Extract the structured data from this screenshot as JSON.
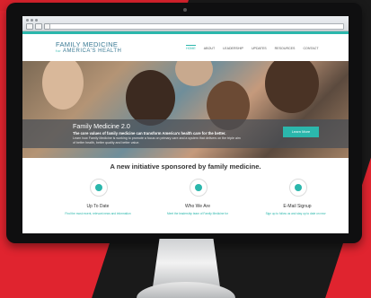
{
  "browser": {
    "url": ""
  },
  "header": {
    "logo_line1": "FAMILY MEDICINE",
    "logo_for": "for",
    "logo_line2": "AMERICA'S HEALTH",
    "nav": [
      "HOME",
      "ABOUT",
      "LEADERSHIP",
      "UPDATES",
      "RESOURCES",
      "CONTACT"
    ]
  },
  "hero": {
    "title": "Family Medicine 2.0",
    "subtitle": "The core values of family medicine can transform America's health care for the better.",
    "body": "Learn how Family Medicine is working to promote a focus on primary care and a system that delivers on the triple aim of better health, better quality and better value.",
    "button_label": "Learn More"
  },
  "main": {
    "heading": "A new initiative sponsored by family medicine.",
    "features": [
      {
        "icon": "book-icon",
        "title": "Up To Date",
        "text": "Find the most recent, relevant news and information"
      },
      {
        "icon": "person-icon",
        "title": "Who We Are",
        "text": "Meet the leadership team of Family Medicine for"
      },
      {
        "icon": "email-icon",
        "title": "E-Mail Signup",
        "text": "Sign up to follow us and stay up to date on new"
      }
    ]
  },
  "colors": {
    "accent": "#2bb7ac",
    "logo": "#3a7a94",
    "background_red": "#e0242f"
  }
}
